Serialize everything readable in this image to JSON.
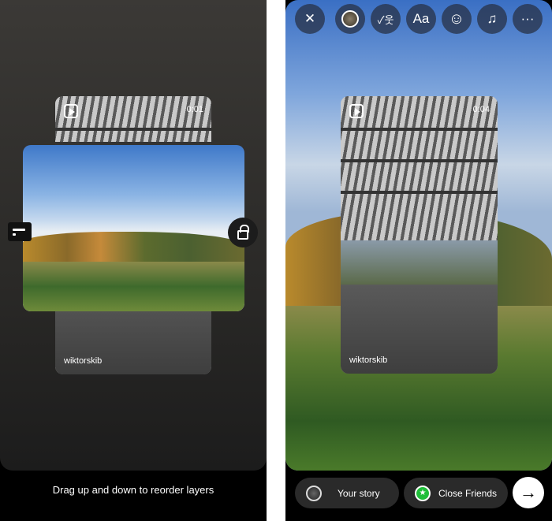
{
  "left_screen": {
    "video_layer": {
      "duration": "0:01",
      "username": "wiktorskib"
    },
    "hint": "Drag up and down to reorder layers"
  },
  "right_screen": {
    "toolbar": [
      {
        "icon": "close-icon",
        "glyph": "✕"
      },
      {
        "icon": "color-circle-icon",
        "glyph": ""
      },
      {
        "icon": "mention-icon",
        "glyph": "✓웃"
      },
      {
        "icon": "text-icon",
        "glyph": "Aa"
      },
      {
        "icon": "sticker-icon",
        "glyph": "☺"
      },
      {
        "icon": "music-icon",
        "glyph": "♫"
      },
      {
        "icon": "more-icon",
        "glyph": "···"
      }
    ],
    "video_layer": {
      "duration": "0:04",
      "username": "wiktorskib"
    },
    "share": {
      "your_story": "Your story",
      "close_friends": "Close Friends",
      "next_glyph": "→"
    },
    "colors": {
      "close_friends": "#1fbe39"
    }
  }
}
